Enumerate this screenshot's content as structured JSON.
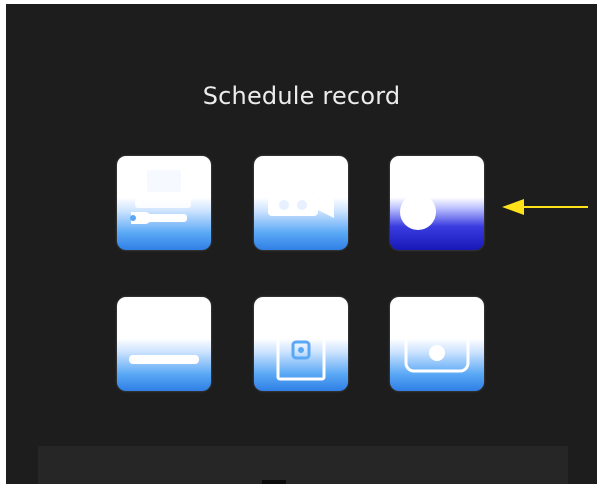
{
  "screen": {
    "title": "Schedule record"
  },
  "menu": {
    "items": [
      {
        "icon": "tools-icon"
      },
      {
        "icon": "camera-icon"
      },
      {
        "icon": "clock-icon",
        "selected": true
      },
      {
        "icon": "download-icon"
      },
      {
        "icon": "disk-icon"
      },
      {
        "icon": "box-icon"
      }
    ]
  },
  "colors": {
    "tile_gradient_end": "#2f7fe6",
    "selected_gradient_end": "#1818b8",
    "background": "#1d1d1d",
    "pointer_arrow": "#ffe21a"
  }
}
